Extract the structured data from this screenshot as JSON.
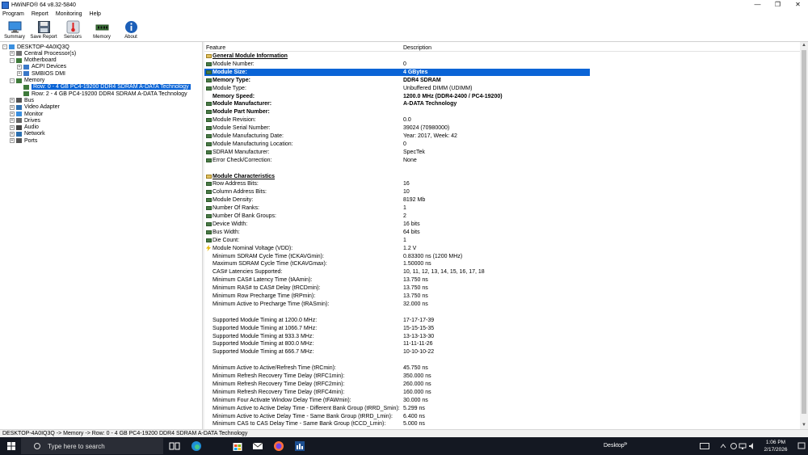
{
  "window": {
    "title": "HWiNFO® 64 v8.32-5840",
    "minimize": "—",
    "maximize": "❐",
    "close": "✕"
  },
  "menu": [
    "Program",
    "Report",
    "Monitoring",
    "Help"
  ],
  "toolbar": [
    {
      "label": "Summary",
      "icon": "monitor-icon"
    },
    {
      "label": "Save Report",
      "icon": "floppy-disk-icon"
    },
    {
      "label": "Sensors",
      "icon": "thermometer-icon"
    },
    {
      "label": "Memory",
      "icon": "memory-module-icon"
    },
    {
      "label": "About",
      "icon": "info-icon"
    }
  ],
  "tree": [
    {
      "label": "DESKTOP-4A0IQ3Q",
      "level": 0,
      "exp": "-",
      "icon": "computer-icon"
    },
    {
      "label": "Central Processor(s)",
      "level": 1,
      "exp": "+",
      "icon": "cpu-icon"
    },
    {
      "label": "Motherboard",
      "level": 1,
      "exp": "-",
      "icon": "motherboard-icon"
    },
    {
      "label": "ACPI Devices",
      "level": 2,
      "exp": "+",
      "icon": "acpi-icon"
    },
    {
      "label": "SMBIOS DMI",
      "level": 2,
      "exp": "+",
      "icon": "dmi-icon"
    },
    {
      "label": "Memory",
      "level": 1,
      "exp": "-",
      "icon": "memory-icon"
    },
    {
      "label": "Row: 0 - 4 GB PC4-19200 DDR4 SDRAM A-DATA Technology",
      "level": 2,
      "exp": "",
      "icon": "memory-module-icon",
      "selected": true
    },
    {
      "label": "Row: 2 - 4 GB PC4-19200 DDR4 SDRAM A-DATA Technology",
      "level": 2,
      "exp": "",
      "icon": "memory-module-icon"
    },
    {
      "label": "Bus",
      "level": 1,
      "exp": "+",
      "icon": "bus-icon"
    },
    {
      "label": "Video Adapter",
      "level": 1,
      "exp": "+",
      "icon": "video-adapter-icon"
    },
    {
      "label": "Monitor",
      "level": 1,
      "exp": "+",
      "icon": "monitor-icon"
    },
    {
      "label": "Drives",
      "level": 1,
      "exp": "+",
      "icon": "drive-icon"
    },
    {
      "label": "Audio",
      "level": 1,
      "exp": "+",
      "icon": "audio-icon"
    },
    {
      "label": "Network",
      "level": 1,
      "exp": "+",
      "icon": "network-icon"
    },
    {
      "label": "Ports",
      "level": 1,
      "exp": "+",
      "icon": "ports-icon"
    }
  ],
  "columns": {
    "feature": "Feature",
    "description": "Description"
  },
  "rows": [
    {
      "f": "General Module Information",
      "v": "",
      "type": "section"
    },
    {
      "f": "Module Number:",
      "v": "0",
      "type": "normal"
    },
    {
      "f": "Module Size:",
      "v": "4 GBytes",
      "type": "bold",
      "selected": true
    },
    {
      "f": "Memory Type:",
      "v": "DDR4 SDRAM",
      "type": "bold"
    },
    {
      "f": "Module Type:",
      "v": "Unbuffered DIMM (UDIMM)",
      "type": "normal"
    },
    {
      "f": "Memory Speed:",
      "v": "1200.0 MHz (DDR4-2400 / PC4-19200)",
      "type": "bold",
      "noicon": true
    },
    {
      "f": "Module Manufacturer:",
      "v": "A-DATA Technology",
      "type": "bold"
    },
    {
      "f": "Module Part Number:",
      "v": "",
      "type": "bold"
    },
    {
      "f": "Module Revision:",
      "v": "0.0",
      "type": "normal"
    },
    {
      "f": "Module Serial Number:",
      "v": "39024 (70980000)",
      "type": "normal"
    },
    {
      "f": "Module Manufacturing Date:",
      "v": "Year: 2017, Week: 42",
      "type": "normal"
    },
    {
      "f": "Module Manufacturing Location:",
      "v": "0",
      "type": "normal"
    },
    {
      "f": "SDRAM Manufacturer:",
      "v": "SpecTek",
      "type": "normal"
    },
    {
      "f": "Error Check/Correction:",
      "v": "None",
      "type": "normal"
    },
    {
      "f": "",
      "v": "",
      "type": "blank"
    },
    {
      "f": "Module Characteristics",
      "v": "",
      "type": "section"
    },
    {
      "f": "Row Address Bits:",
      "v": "16",
      "type": "normal"
    },
    {
      "f": "Column Address Bits:",
      "v": "10",
      "type": "normal"
    },
    {
      "f": "Module Density:",
      "v": "8192 Mb",
      "type": "normal"
    },
    {
      "f": "Number Of Ranks:",
      "v": "1",
      "type": "normal"
    },
    {
      "f": "Number Of Bank Groups:",
      "v": "2",
      "type": "normal"
    },
    {
      "f": "Device Width:",
      "v": "16 bits",
      "type": "normal"
    },
    {
      "f": "Bus Width:",
      "v": "64 bits",
      "type": "normal"
    },
    {
      "f": "Die Count:",
      "v": "1",
      "type": "normal"
    },
    {
      "f": "Module Nominal Voltage (VDD):",
      "v": "1.2 V",
      "type": "normal",
      "bolt": true
    },
    {
      "f": "Minimum SDRAM Cycle Time (tCKAVGmin):",
      "v": "0.83300 ns (1200 MHz)",
      "type": "normal",
      "noicon": true
    },
    {
      "f": "Maximum SDRAM Cycle Time (tCKAVGmax):",
      "v": "1.50000 ns",
      "type": "normal",
      "noicon": true
    },
    {
      "f": "CAS# Latencies Supported:",
      "v": "10, 11, 12, 13, 14, 15, 16, 17, 18",
      "type": "normal",
      "noicon": true
    },
    {
      "f": "Minimum CAS# Latency Time (tAAmin):",
      "v": "13.750 ns",
      "type": "normal",
      "noicon": true
    },
    {
      "f": "Minimum RAS# to CAS# Delay (tRCDmin):",
      "v": "13.750 ns",
      "type": "normal",
      "noicon": true
    },
    {
      "f": "Minimum Row Precharge Time (tRPmin):",
      "v": "13.750 ns",
      "type": "normal",
      "noicon": true
    },
    {
      "f": "Minimum Active to Precharge Time (tRASmin):",
      "v": "32.000 ns",
      "type": "normal",
      "noicon": true
    },
    {
      "f": "",
      "v": "",
      "type": "blank"
    },
    {
      "f": "Supported Module Timing at 1200.0 MHz:",
      "v": "17-17-17-39",
      "type": "normal",
      "noicon": true
    },
    {
      "f": "Supported Module Timing at 1066.7 MHz:",
      "v": "15-15-15-35",
      "type": "normal",
      "noicon": true
    },
    {
      "f": "Supported Module Timing at 933.3 MHz:",
      "v": "13-13-13-30",
      "type": "normal",
      "noicon": true
    },
    {
      "f": "Supported Module Timing at 800.0 MHz:",
      "v": "11-11-11-26",
      "type": "normal",
      "noicon": true
    },
    {
      "f": "Supported Module Timing at 666.7 MHz:",
      "v": "10-10-10-22",
      "type": "normal",
      "noicon": true
    },
    {
      "f": "",
      "v": "",
      "type": "blank"
    },
    {
      "f": "Minimum Active to Active/Refresh Time (tRCmin):",
      "v": "45.750 ns",
      "type": "normal",
      "noicon": true
    },
    {
      "f": "Minimum Refresh Recovery Time Delay (tRFC1min):",
      "v": "350.000 ns",
      "type": "normal",
      "noicon": true
    },
    {
      "f": "Minimum Refresh Recovery Time Delay (tRFC2min):",
      "v": "260.000 ns",
      "type": "normal",
      "noicon": true
    },
    {
      "f": "Minimum Refresh Recovery Time Delay (tRFC4min):",
      "v": "160.000 ns",
      "type": "normal",
      "noicon": true
    },
    {
      "f": "Minimum Four Activate Window Delay Time (tFAWmin):",
      "v": "30.000 ns",
      "type": "normal",
      "noicon": true
    },
    {
      "f": "Minimum Active to Active Delay Time - Different Bank Group (tRRD_Smin):",
      "v": "5.299 ns",
      "type": "normal",
      "noicon": true
    },
    {
      "f": "Minimum Active to Active Delay Time - Same Bank Group (tRRD_Lmin):",
      "v": "6.400 ns",
      "type": "normal",
      "noicon": true
    },
    {
      "f": "Minimum CAS to CAS Delay Time - Same Bank Group (tCCD_Lmin):",
      "v": "5.000 ns",
      "type": "normal",
      "noicon": true
    }
  ],
  "status": "DESKTOP-4A0IQ3Q -> Memory -> Row: 0 - 4 GB PC4-19200 DDR4 SDRAM A-DATA Technology",
  "taskbar": {
    "search_placeholder": "Type here to search",
    "desktop_label": "Desktop",
    "desktop_chevron": "»",
    "time": "1:06 PM",
    "date": "2/17/2026",
    "apps": [
      "task-view-icon",
      "edge-icon",
      "store-icon",
      "mail-icon",
      "firefox-icon",
      "hwinfo-icon"
    ]
  },
  "colors": {
    "selection": "#0a64d6",
    "taskbar": "#141822",
    "section_icon": "#e0c060",
    "module_icon": "#4a7a46"
  }
}
